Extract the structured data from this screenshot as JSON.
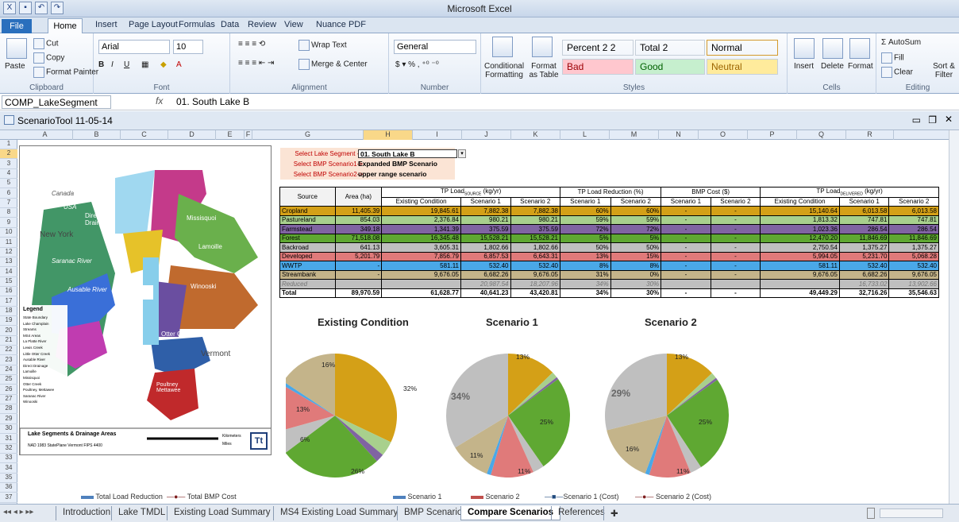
{
  "window": {
    "title": "Microsoft Excel"
  },
  "ribbon_tabs": [
    "File",
    "Home",
    "Insert",
    "Page Layout",
    "Formulas",
    "Data",
    "Review",
    "View",
    "Nuance PDF"
  ],
  "clipboard": {
    "paste": "Paste",
    "cut": "Cut",
    "copy": "Copy",
    "format_painter": "Format Painter",
    "label": "Clipboard"
  },
  "font": {
    "name": "Arial",
    "size": "10",
    "label": "Font"
  },
  "alignment": {
    "wrap": "Wrap Text",
    "merge": "Merge & Center",
    "label": "Alignment"
  },
  "number": {
    "format": "General",
    "label": "Number"
  },
  "styles": {
    "cond": "Conditional Formatting",
    "table": "Format as Table",
    "cells": [
      {
        "name": "Percent 2 2",
        "bg": "#ffffff",
        "fg": "#000000"
      },
      {
        "name": "Total 2",
        "bg": "#ffffff",
        "fg": "#000000"
      },
      {
        "name": "Normal",
        "bg": "#ffffff",
        "fg": "#000000"
      },
      {
        "name": "Bad",
        "bg": "#ffc7ce",
        "fg": "#9c0006"
      },
      {
        "name": "Good",
        "bg": "#c6efce",
        "fg": "#006100"
      },
      {
        "name": "Neutral",
        "bg": "#ffeb9c",
        "fg": "#9c6500"
      }
    ],
    "label": "Styles"
  },
  "cells_group": {
    "insert": "Insert",
    "delete": "Delete",
    "format": "Format",
    "label": "Cells"
  },
  "editing": {
    "autosum": "AutoSum",
    "fill": "Fill",
    "clear": "Clear",
    "sort": "Sort & Filter",
    "label": "Editing"
  },
  "name_box": "COMP_LakeSegment",
  "formula_fx": "fx",
  "formula": "01. South Lake B",
  "workbook": {
    "title": "ScenarioTool 11-05-14"
  },
  "columns": [
    "A",
    "B",
    "C",
    "D",
    "E",
    "F",
    "G",
    "H",
    "I",
    "J",
    "K",
    "L",
    "M",
    "N",
    "O",
    "P",
    "Q",
    "R"
  ],
  "rows": [
    "1",
    "2",
    "3",
    "4",
    "5",
    "6",
    "7",
    "8",
    "9",
    "10",
    "11",
    "12",
    "13",
    "14",
    "15",
    "16",
    "17",
    "18",
    "19",
    "20",
    "21",
    "22",
    "23",
    "24",
    "25",
    "26",
    "27",
    "28",
    "29",
    "30",
    "31",
    "32",
    "33",
    "34",
    "35",
    "36",
    "37"
  ],
  "map": {
    "labels": [
      "Canada",
      "USA",
      "New York",
      "Direct Drainage",
      "Missisquoi",
      "Lamoille",
      "Saranac River",
      "Ausable River",
      "Winooski",
      "Otter Creek",
      "Vermont",
      "Poultney Mettawee"
    ],
    "legend_title": "Legend",
    "legend": [
      "State Boundary",
      "Lake Champlain",
      "Streams",
      "MS4 Areas",
      "La Platte River",
      "Lewis Creek",
      "Little Otter Creek",
      "Ausable River",
      "Direct Drainage",
      "Lamoille",
      "Missisquoi",
      "Otter Creek",
      "Poultney, Mettawee",
      "Saranac River",
      "Winooski"
    ],
    "footer_title": "Lake Segments & Drainage Areas",
    "footer_sub": "NAD 1983 StatePlane Vermont FIPS 4400",
    "scale_units": [
      "Kilometers",
      "Miles"
    ],
    "logo": "Tt"
  },
  "selectors": [
    {
      "label": "Select Lake Segment ->",
      "value": "01. South Lake B"
    },
    {
      "label": "Select BMP Scenario1->",
      "value": "Expanded BMP Scenario"
    },
    {
      "label": "Select BMP Scenario2->",
      "value": "upper range scenario"
    }
  ],
  "table": {
    "top_headers": [
      "Source",
      "Area (ha)",
      "TP Load",
      "SOURCE",
      "(kg/yr)",
      "TP Load Reduction (%)",
      "BMP Cost ($)",
      "TP Load",
      "DELIVERED",
      "(kg/yr)"
    ],
    "sub_headers": [
      "Existing Condition",
      "Scenario 1",
      "Scenario 2",
      "Scenario 1",
      "Scenario 2",
      "Scenario 1",
      "Scenario 2",
      "Existing Condition",
      "Scenario 1",
      "Scenario 2"
    ],
    "rows": [
      {
        "source": "Cropland",
        "color": "#d4a017",
        "cells": [
          "11,405.39",
          "19,845.61",
          "7,882.38",
          "7,882.38",
          "60%",
          "60%",
          "-",
          "-",
          "15,140.64",
          "6,013.58",
          "6,013.58"
        ]
      },
      {
        "source": "Pastureland",
        "color": "#a8d08d",
        "cells": [
          "854.03",
          "2,376.84",
          "980.21",
          "980.21",
          "59%",
          "59%",
          "-",
          "-",
          "1,813.32",
          "747.81",
          "747.81"
        ]
      },
      {
        "source": "Farmstead",
        "color": "#8064a2",
        "cells": [
          "349.18",
          "1,341.39",
          "375.59",
          "375.59",
          "72%",
          "72%",
          "-",
          "-",
          "1,023.36",
          "286.54",
          "286.54"
        ]
      },
      {
        "source": "Forest",
        "color": "#5fa832",
        "cells": [
          "71,518.08",
          "16,345.48",
          "15,528.21",
          "15,528.21",
          "5%",
          "5%",
          "-",
          "-",
          "12,470.20",
          "11,846.69",
          "11,846.69"
        ]
      },
      {
        "source": "Backroad",
        "color": "#c0c0c0",
        "cells": [
          "641.13",
          "3,605.31",
          "1,802.66",
          "1,802.66",
          "50%",
          "50%",
          "-",
          "-",
          "2,750.54",
          "1,375.27",
          "1,375.27"
        ]
      },
      {
        "source": "Developed",
        "color": "#e07a7a",
        "cells": [
          "5,201.79",
          "7,856.79",
          "6,857.53",
          "6,643.31",
          "13%",
          "15%",
          "-",
          "-",
          "5,994.05",
          "5,231.70",
          "5,068.28"
        ]
      },
      {
        "source": "WWTP",
        "color": "#4aa8e8",
        "cells": [
          "-",
          "581.11",
          "532.40",
          "532.40",
          "8%",
          "8%",
          "-",
          "-",
          "581.11",
          "532.40",
          "532.40"
        ]
      },
      {
        "source": "Streambank",
        "color": "#c4b48a",
        "cells": [
          "-",
          "9,676.05",
          "6,682.26",
          "9,676.05",
          "31%",
          "0%",
          "-",
          "-",
          "9,676.05",
          "6,682.26",
          "9,676.05"
        ]
      },
      {
        "source": "Reduced",
        "color": "#bfbfbf",
        "cells": [
          "",
          "",
          "20,987.54",
          "18,207.96",
          "34%",
          "30%",
          "",
          "",
          "",
          "16,733.02",
          "13,902.66"
        ]
      },
      {
        "source": "Total",
        "color": "#ffffff",
        "cells": [
          "89,970.59",
          "61,628.77",
          "40,641.23",
          "43,420.81",
          "34%",
          "30%",
          "-",
          "-",
          "49,449.29",
          "32,716.26",
          "35,546.63"
        ]
      }
    ]
  },
  "pies": [
    {
      "title": "Existing Condition",
      "slices": [
        {
          "name": "Cropland",
          "value": 32,
          "color": "#d4a017"
        },
        {
          "name": "Pastureland",
          "value": 3.9,
          "color": "#a8d08d"
        },
        {
          "name": "Farmstead",
          "value": 2.2,
          "color": "#8064a2"
        },
        {
          "name": "Forest",
          "value": 26.5,
          "color": "#5fa832"
        },
        {
          "name": "Backroad",
          "value": 5.9,
          "color": "#c0c0c0"
        },
        {
          "name": "Developed",
          "value": 12.7,
          "color": "#e07a7a"
        },
        {
          "name": "WWTP",
          "value": 0.9,
          "color": "#4aa8e8"
        },
        {
          "name": "Streambank",
          "value": 15.7,
          "color": "#c4b48a"
        }
      ],
      "labels": [
        "32%",
        "26%",
        "6%",
        "13%",
        "16%"
      ]
    },
    {
      "title": "Scenario 1",
      "slices": [
        {
          "name": "Cropland",
          "value": 12.9,
          "color": "#d4a017"
        },
        {
          "name": "Pastureland",
          "value": 1.6,
          "color": "#a8d08d"
        },
        {
          "name": "Farmstead",
          "value": 0.6,
          "color": "#8064a2"
        },
        {
          "name": "Forest",
          "value": 25.5,
          "color": "#5fa832"
        },
        {
          "name": "Backroad",
          "value": 3.0,
          "color": "#c0c0c0"
        },
        {
          "name": "Developed",
          "value": 11.3,
          "color": "#e07a7a"
        },
        {
          "name": "WWTP",
          "value": 1.1,
          "color": "#4aa8e8"
        },
        {
          "name": "Streambank",
          "value": 10.8,
          "color": "#c4b48a"
        },
        {
          "name": "Reduced",
          "value": 33.9,
          "color": "#bfbfbf"
        }
      ],
      "labels": [
        "13%",
        "25%",
        "11%",
        "11%",
        "34%"
      ]
    },
    {
      "title": "Scenario 2",
      "slices": [
        {
          "name": "Cropland",
          "value": 13.0,
          "color": "#d4a017"
        },
        {
          "name": "Pastureland",
          "value": 1.6,
          "color": "#a8d08d"
        },
        {
          "name": "Farmstead",
          "value": 0.6,
          "color": "#8064a2"
        },
        {
          "name": "Forest",
          "value": 25.5,
          "color": "#5fa832"
        },
        {
          "name": "Backroad",
          "value": 3.0,
          "color": "#c0c0c0"
        },
        {
          "name": "Developed",
          "value": 10.9,
          "color": "#e07a7a"
        },
        {
          "name": "WWTP",
          "value": 1.1,
          "color": "#4aa8e8"
        },
        {
          "name": "Streambank",
          "value": 15.5,
          "color": "#c4b48a"
        },
        {
          "name": "Reduced",
          "value": 28.8,
          "color": "#bfbfbf"
        }
      ],
      "labels": [
        "13%",
        "25%",
        "11%",
        "16%",
        "29%"
      ]
    }
  ],
  "bottom_legend_left": [
    "Total Load Reduction",
    "Total BMP Cost"
  ],
  "bottom_legend_right": [
    "Scenario 1",
    "Scenario 2",
    "Scenario 1 (Cost)",
    "Scenario 2 (Cost)"
  ],
  "sheet_tabs": [
    "Introduction",
    "Lake TMDL",
    "Existing Load Summary",
    "MS4 Existing Load Summary",
    "BMP Scenario",
    "Compare Scenarios",
    "References"
  ],
  "active_sheet": "Compare Scenarios"
}
